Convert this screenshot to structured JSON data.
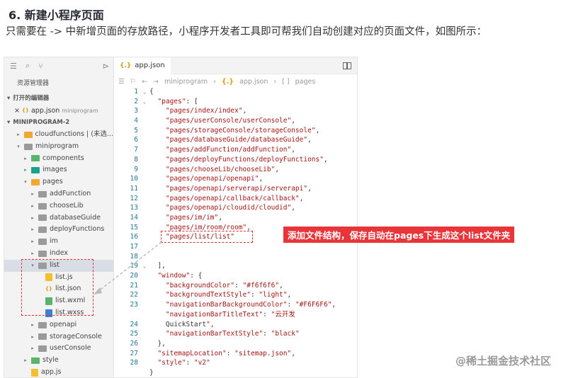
{
  "article": {
    "title": "6. 新建小程序页面",
    "para_before": "只需要在 ",
    "code1": "app.json",
    "arrow": " -> ",
    "code2": "pages",
    "para_after": " 中新增页面的存放路径，小程序开发者工具即可帮我们自动创建对应的页面文件，如图所示："
  },
  "sidebar": {
    "header": "资源管理器",
    "open_editors_label": "打开的编辑器",
    "open_file": "app.json",
    "open_file_sub": "miniprogram",
    "project_label": "MINIPROGRAM-2",
    "tree": [
      {
        "indent": 1,
        "twisty": "▸",
        "icon": "folder-o",
        "label": "cloudfunctions | (未选..."
      },
      {
        "indent": 1,
        "twisty": "▾",
        "icon": "folder",
        "label": "miniprogram"
      },
      {
        "indent": 2,
        "twisty": "▸",
        "icon": "folder-g",
        "label": "components"
      },
      {
        "indent": 2,
        "twisty": "▸",
        "icon": "folder-t",
        "label": "images"
      },
      {
        "indent": 2,
        "twisty": "▾",
        "icon": "folder-y",
        "label": "pages"
      },
      {
        "indent": 3,
        "twisty": "▸",
        "icon": "folder",
        "label": "addFunction"
      },
      {
        "indent": 3,
        "twisty": "▸",
        "icon": "folder",
        "label": "chooseLib"
      },
      {
        "indent": 3,
        "twisty": "▸",
        "icon": "folder",
        "label": "databaseGuide"
      },
      {
        "indent": 3,
        "twisty": "▸",
        "icon": "folder",
        "label": "deployFunctions"
      },
      {
        "indent": 3,
        "twisty": "▸",
        "icon": "folder",
        "label": "im"
      },
      {
        "indent": 3,
        "twisty": "▸",
        "icon": "folder",
        "label": "index"
      },
      {
        "indent": 3,
        "twisty": "▾",
        "icon": "folder",
        "label": "list",
        "selected": true
      },
      {
        "indent": 4,
        "twisty": "",
        "icon": "js",
        "label": "list.js"
      },
      {
        "indent": 4,
        "twisty": "",
        "icon": "json",
        "label": "list.json"
      },
      {
        "indent": 4,
        "twisty": "",
        "icon": "wxml",
        "label": "list.wxml"
      },
      {
        "indent": 4,
        "twisty": "",
        "icon": "wxss",
        "label": "list.wxss"
      },
      {
        "indent": 3,
        "twisty": "▸",
        "icon": "folder",
        "label": "openapi"
      },
      {
        "indent": 3,
        "twisty": "▸",
        "icon": "folder",
        "label": "storageConsole"
      },
      {
        "indent": 3,
        "twisty": "▸",
        "icon": "folder",
        "label": "userConsole"
      },
      {
        "indent": 2,
        "twisty": "▸",
        "icon": "folder-g",
        "label": "style"
      },
      {
        "indent": 2,
        "twisty": "",
        "icon": "js",
        "label": "app.js"
      }
    ]
  },
  "editor": {
    "tab_label": "app.json",
    "crumb_root": "miniprogram",
    "crumb_file": "app.json",
    "crumb_key": "pages",
    "lines": [
      {
        "n": "1",
        "fold": "⌄",
        "t": "{"
      },
      {
        "n": "2",
        "fold": "⌄",
        "t": "  \"pages\": ["
      },
      {
        "n": "3",
        "fold": "",
        "t": "    \"pages/index/index\","
      },
      {
        "n": "4",
        "fold": "",
        "t": "    \"pages/userConsole/userConsole\","
      },
      {
        "n": "5",
        "fold": "",
        "t": "    \"pages/storageConsole/storageConsole\","
      },
      {
        "n": "6",
        "fold": "",
        "t": "    \"pages/databaseGuide/databaseGuide\","
      },
      {
        "n": "7",
        "fold": "",
        "t": "    \"pages/addFunction/addFunction\","
      },
      {
        "n": "8",
        "fold": "",
        "t": "    \"pages/deployFunctions/deployFunctions\","
      },
      {
        "n": "9",
        "fold": "",
        "t": "    \"pages/chooseLib/chooseLib\","
      },
      {
        "n": "10",
        "fold": "",
        "t": "    \"pages/openapi/openapi\","
      },
      {
        "n": "11",
        "fold": "",
        "t": "    \"pages/openapi/serverapi/serverapi\","
      },
      {
        "n": "12",
        "fold": "",
        "t": "    \"pages/openapi/callback/callback\","
      },
      {
        "n": "13",
        "fold": "",
        "t": "    \"pages/openapi/cloudid/cloudid\","
      },
      {
        "n": "14",
        "fold": "",
        "t": "    \"pages/im/im\","
      },
      {
        "n": "15",
        "fold": "",
        "t": "    \"pages/im/room/room\","
      },
      {
        "n": "16",
        "fold": "",
        "t": "    \"pages/list/list\""
      },
      {
        "n": "17",
        "fold": "",
        "t": ""
      },
      {
        "n": "18",
        "fold": "",
        "t": ""
      },
      {
        "n": "19",
        "fold": "⌄",
        "t": "  ],"
      },
      {
        "n": "20",
        "fold": "",
        "t": "  \"window\": {"
      },
      {
        "n": "21",
        "fold": "",
        "t": "    \"backgroundColor\": \"#f6f6f6\","
      },
      {
        "n": "22",
        "fold": "",
        "t": "    \"backgroundTextStyle\": \"light\","
      },
      {
        "n": "23",
        "fold": "",
        "t": "    \"navigationBarBackgroundColor\": \"#F6F6F6\","
      },
      {
        "n": "",
        "fold": "",
        "t": "    \"navigationBarTitleText\": \"云开发"
      },
      {
        "n": "24",
        "fold": "",
        "t": "    QuickStart\","
      },
      {
        "n": "25",
        "fold": "",
        "t": "    \"navigationBarTextStyle\": \"black\""
      },
      {
        "n": "26",
        "fold": "",
        "t": "  },"
      },
      {
        "n": "27",
        "fold": "",
        "t": "  \"sitemapLocation\": \"sitemap.json\","
      },
      {
        "n": "28",
        "fold": "",
        "t": "  \"style\": \"v2\""
      },
      {
        "n": "",
        "fold": "",
        "t": "}"
      }
    ]
  },
  "annotation": "添加文件结构，保存自动在pages下生成这个list文件夹",
  "watermark": "@稀土掘金技术社区",
  "colors": {
    "accent_red": "#e8353a",
    "code_string": "#a31515",
    "line_number": "#237893"
  }
}
